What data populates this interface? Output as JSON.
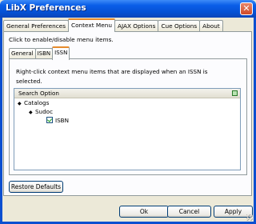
{
  "window": {
    "title": "LibX Preferences",
    "close_glyph": "✕"
  },
  "top_tabs": [
    {
      "label": "General Preferences",
      "active": false
    },
    {
      "label": "Context Menu",
      "active": true
    },
    {
      "label": "AJAX Options",
      "active": false
    },
    {
      "label": "Cue Options",
      "active": false
    },
    {
      "label": "About",
      "active": false
    }
  ],
  "context_menu": {
    "instruction": "Click to enable/disable menu items.",
    "sub_tabs": [
      {
        "label": "General",
        "active": false
      },
      {
        "label": "ISBN",
        "active": false
      },
      {
        "label": "ISSN",
        "active": true
      }
    ],
    "description": "Right-click context menu items that are displayed when an ISSN is selected.",
    "tree": {
      "column_header": "Search Option",
      "column_picker_icon": "column-picker-icon",
      "rows": [
        {
          "label": "Catalogs",
          "expanded": true,
          "level": 0,
          "checkbox": false
        },
        {
          "label": "Sudoc",
          "expanded": true,
          "level": 1,
          "checkbox": false
        },
        {
          "label": "ISBN",
          "level": 2,
          "checkbox": true,
          "checked": true
        }
      ]
    }
  },
  "buttons": {
    "restore_defaults": "Restore Defaults",
    "ok": "Ok",
    "cancel": "Cancel",
    "apply": "Apply"
  },
  "colors": {
    "titlebar": "#0551d4",
    "active_tab_accent": "#e68b2c",
    "dialog_bg": "#ece9d8"
  }
}
